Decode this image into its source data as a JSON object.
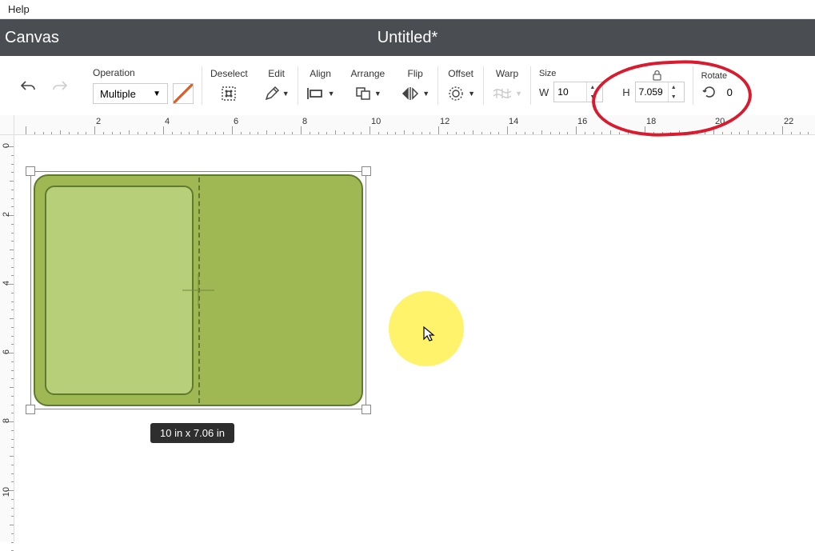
{
  "menubar": {
    "help": "Help"
  },
  "header": {
    "canvas_label": "Canvas",
    "project_title": "Untitled*"
  },
  "toolbar": {
    "operation": {
      "label": "Operation",
      "value": "Multiple"
    },
    "deselect": "Deselect",
    "edit": "Edit",
    "align": "Align",
    "arrange": "Arrange",
    "flip": "Flip",
    "offset": "Offset",
    "warp": "Warp",
    "size": {
      "label": "Size",
      "w_label": "W",
      "w_value": "10",
      "h_label": "H",
      "h_value": "7.059"
    },
    "rotate": {
      "label": "Rotate",
      "value": "0"
    }
  },
  "ruler_h": [
    "2",
    "4",
    "6",
    "8",
    "10",
    "12",
    "14",
    "16",
    "18",
    "20",
    "22"
  ],
  "ruler_v": [
    "0",
    "2",
    "4",
    "6",
    "8",
    "10"
  ],
  "selection": {
    "dimensions_label": "10  in x 7.06  in"
  },
  "colors": {
    "card_fill": "#a0b854",
    "card_stroke": "#5d7a2e",
    "card_inner": "#b8cf7a",
    "highlight": "#fef36b",
    "annotation": "#d81b2e"
  }
}
